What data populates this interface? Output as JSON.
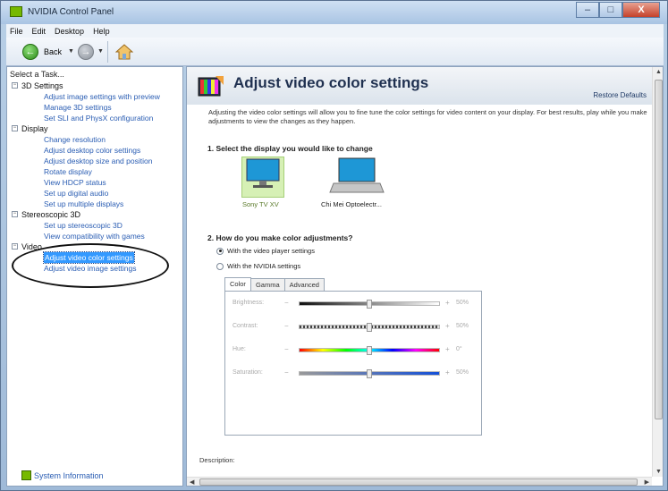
{
  "window": {
    "title": "NVIDIA Control Panel",
    "controls": [
      "–",
      "□",
      "X"
    ]
  },
  "menu": [
    "File",
    "Edit",
    "Desktop",
    "Help"
  ],
  "toolbar": {
    "back_label": "Back"
  },
  "left": {
    "task_header": "Select a Task...",
    "sections": [
      {
        "label": "3D Settings",
        "items": [
          "Adjust image settings with preview",
          "Manage 3D settings",
          "Set SLI and PhysX configuration"
        ]
      },
      {
        "label": "Display",
        "items": [
          "Change resolution",
          "Adjust desktop color settings",
          "Adjust desktop size and position",
          "Rotate display",
          "View HDCP status",
          "Set up digital audio",
          "Set up multiple displays"
        ]
      },
      {
        "label": "Stereoscopic 3D",
        "items": [
          "Set up stereoscopic 3D",
          "View compatibility with games"
        ]
      },
      {
        "label": "Video",
        "items": [
          "Adjust video color settings",
          "Adjust video image settings"
        ]
      }
    ],
    "system_info": "System Information"
  },
  "page": {
    "title": "Adjust video color settings",
    "restore_defaults": "Restore Defaults",
    "intro": "Adjusting the video color settings will allow you to fine tune the color settings for video content on your display. For best results, play while you make adjustments to view the changes as they happen.",
    "section1": "1. Select the display you would like to change",
    "displays": [
      {
        "name": "Sony TV XV",
        "selected": true
      },
      {
        "name": "Chi Mei Optoelectr...",
        "selected": false
      }
    ],
    "section2": "2. How do you make color adjustments?",
    "option1": "With the video player settings",
    "option2": "With the NVIDIA settings",
    "tabs": [
      "Color",
      "Gamma",
      "Advanced"
    ],
    "sliders": [
      {
        "label": "Brightness:",
        "value": "50%",
        "level": 0.5
      },
      {
        "label": "Contrast:",
        "value": "50%",
        "level": 0.5
      },
      {
        "label": "Hue:",
        "value": "0°",
        "level": 0.5
      },
      {
        "label": "Saturation:",
        "value": "50%",
        "level": 0.5
      }
    ],
    "description_label": "Description:"
  },
  "colors": {
    "nvidia_green": "#76b900",
    "link_blue": "#2a5db3",
    "selection": "#3399ff"
  }
}
